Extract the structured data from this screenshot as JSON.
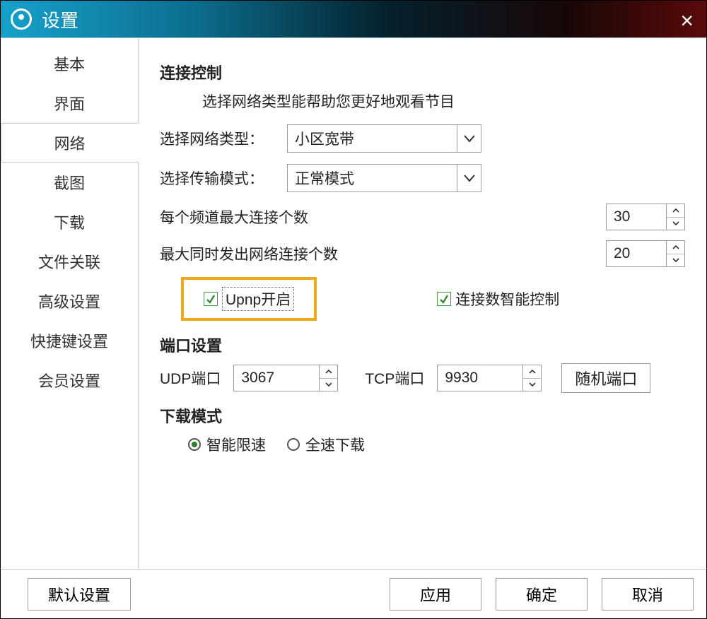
{
  "title": "设置",
  "sidebar": {
    "items": [
      "基本",
      "界面",
      "网络",
      "截图",
      "下载",
      "文件关联",
      "高级设置",
      "快捷键设置",
      "会员设置"
    ],
    "activeIndex": 2
  },
  "main": {
    "section_conn": "连接控制",
    "conn_desc": "选择网络类型能帮助您更好地观看节目",
    "net_type_label": "选择网络类型：",
    "net_type_value": "小区宽带",
    "trans_mode_label": "选择传输模式：",
    "trans_mode_value": "正常模式",
    "max_chan_label": "每个频道最大连接个数",
    "max_chan_value": "30",
    "max_out_label": "最大同时发出网络连接个数",
    "max_out_value": "20",
    "upnp_label": "Upnp开启",
    "smart_label": "连接数智能控制",
    "section_port": "端口设置",
    "udp_label": "UDP端口",
    "udp_value": "3067",
    "tcp_label": "TCP端口",
    "tcp_value": "9930",
    "rand_port_btn": "随机端口",
    "section_dl": "下载模式",
    "radio_smart": "智能限速",
    "radio_full": "全速下载"
  },
  "footer": {
    "default_btn": "默认设置",
    "apply_btn": "应用",
    "ok_btn": "确定",
    "cancel_btn": "取消"
  }
}
